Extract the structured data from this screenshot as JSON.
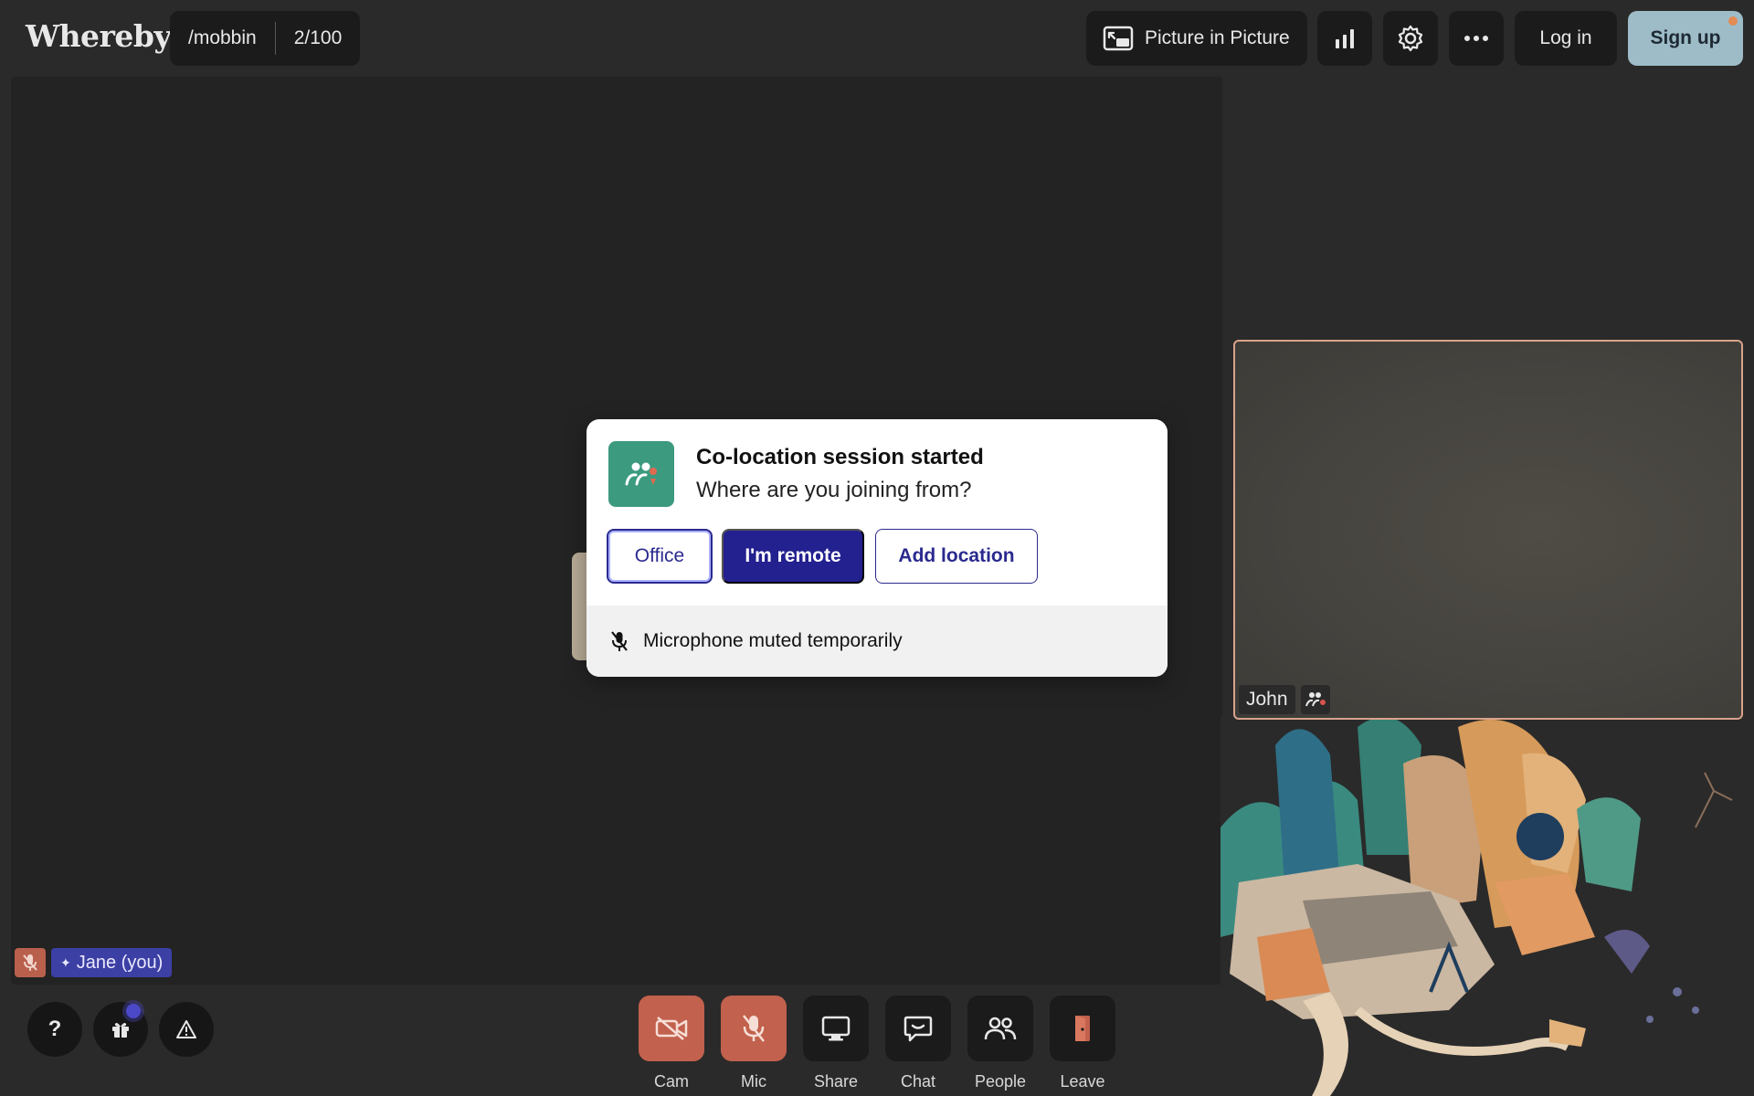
{
  "app": {
    "logo": "Whereby"
  },
  "room": {
    "name": "/mobbin",
    "capacity": "2/100"
  },
  "toolbar": {
    "pip_label": "Picture in Picture",
    "login_label": "Log in",
    "signup_label": "Sign up"
  },
  "participants": {
    "self_name": "Jane (you)",
    "remote_name": "John"
  },
  "dialog": {
    "title": "Co-location session started",
    "subtitle": "Where are you joining from?",
    "options": [
      "Office",
      "I'm remote",
      "Add location"
    ],
    "footer": "Microphone muted temporarily"
  },
  "utility": {
    "help_label": "?"
  },
  "controls": {
    "cam": "Cam",
    "mic": "Mic",
    "share": "Share",
    "chat": "Chat",
    "people": "People",
    "leave": "Leave"
  },
  "colors": {
    "accent": "#23208f",
    "muted_red": "#c2614d",
    "coloc_green": "#3c9a7f",
    "signup_bg": "#9ebcc8",
    "remote_border": "#d9a38b"
  }
}
